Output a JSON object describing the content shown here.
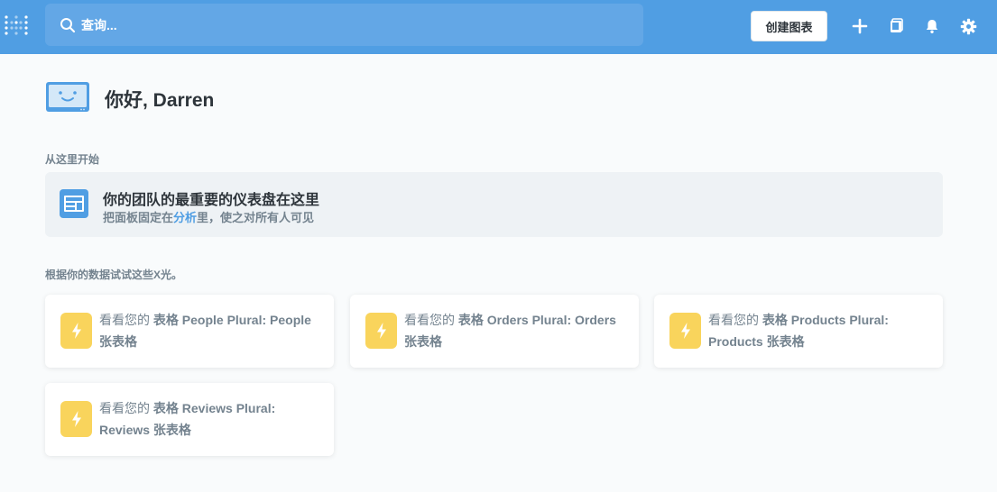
{
  "topbar": {
    "search_placeholder": "查询...",
    "create_button_label": "创建图表",
    "icons": [
      "metabase-logo-icon",
      "search-icon",
      "plus-icon",
      "collection-icon",
      "bell-icon",
      "gear-icon"
    ],
    "colors": {
      "brand": "#509ee3",
      "search_bg": "#63a7e6"
    }
  },
  "greeting": {
    "text": "你好, Darren"
  },
  "start_section": {
    "label": "从这里开始",
    "pin_card": {
      "title": "你的团队的最重要的仪表盘在这里",
      "subtitle_before": "把面板固定在",
      "subtitle_link": "分析",
      "subtitle_after": "里，使之对所有人可见"
    }
  },
  "xray_section": {
    "label": "根据你的数据试试这些X光。",
    "cards": [
      {
        "prefix": "看看您的",
        "main": "表格 People Plural: People 张表格"
      },
      {
        "prefix": "看看您的",
        "main": "表格 Orders Plural: Orders 张表格"
      },
      {
        "prefix": "看看您的",
        "main": "表格 Products Plural: Products 张表格"
      },
      {
        "prefix": "看看您的",
        "main": "表格 Reviews Plural: Reviews 张表格"
      }
    ],
    "colors": {
      "bolt_bg": "#f9d45c"
    }
  }
}
